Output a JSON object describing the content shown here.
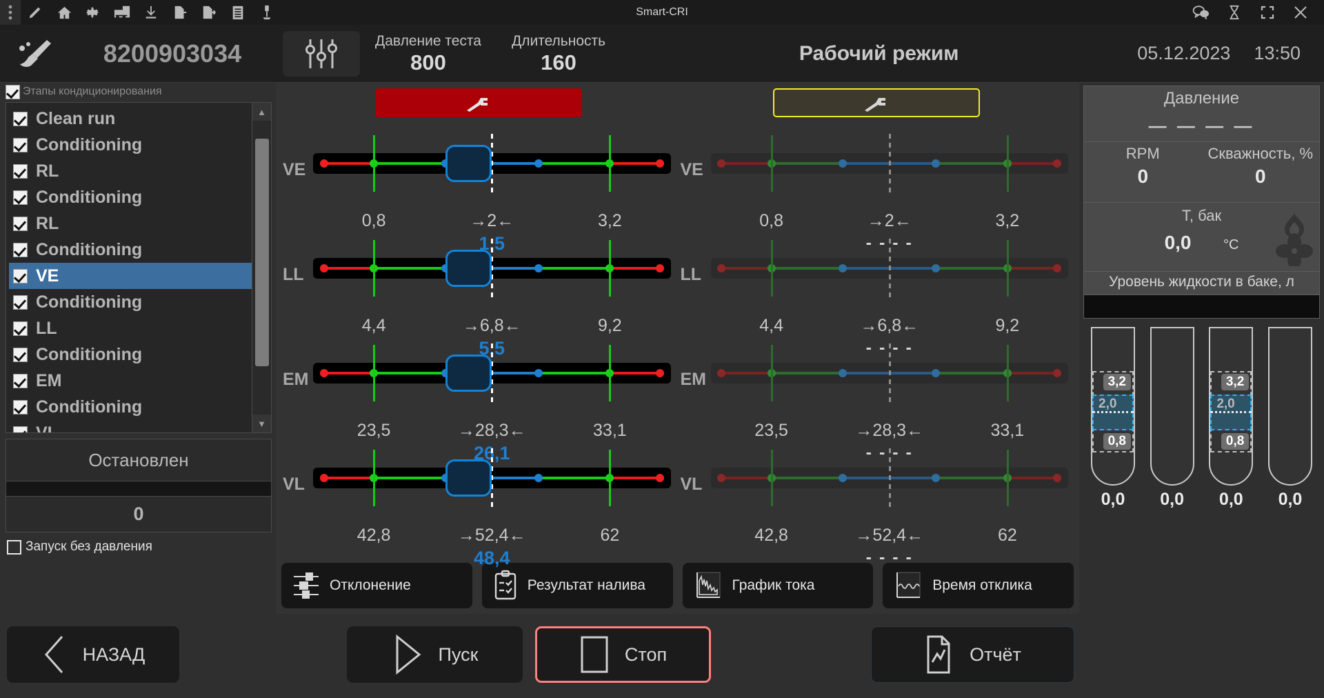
{
  "titlebar": {
    "app_title": "Smart-CRI",
    "left_icons": [
      "grip-dots-icon",
      "pencil-icon",
      "home-icon",
      "gear-icon",
      "toolbox-icon",
      "download-icon",
      "import-icon",
      "export-icon",
      "clipboard-icon",
      "injector-test-icon"
    ],
    "right_icons": [
      "chat-icon",
      "hourglass-icon",
      "fullscreen-icon",
      "close-icon"
    ]
  },
  "header": {
    "brush_icon": "brush-icon",
    "serial": "8200903034",
    "sliders_icon": "sliders-icon",
    "params": [
      {
        "label": "Давление теста",
        "value": "800"
      },
      {
        "label": "Длительность",
        "value": "160"
      }
    ],
    "mode": "Рабочий режим",
    "date": "05.12.2023",
    "time": "13:50"
  },
  "sidebar": {
    "stages_title": "Этапы кондиционирования",
    "stages_checked": true,
    "stages": [
      {
        "label": "Clean run",
        "checked": true,
        "selected": false
      },
      {
        "label": "Conditioning",
        "checked": true,
        "selected": false
      },
      {
        "label": "RL",
        "checked": true,
        "selected": false
      },
      {
        "label": "Conditioning",
        "checked": true,
        "selected": false
      },
      {
        "label": "RL",
        "checked": true,
        "selected": false
      },
      {
        "label": "Conditioning",
        "checked": true,
        "selected": false
      },
      {
        "label": "VE",
        "checked": true,
        "selected": true
      },
      {
        "label": "Conditioning",
        "checked": true,
        "selected": false
      },
      {
        "label": "LL",
        "checked": true,
        "selected": false
      },
      {
        "label": "Conditioning",
        "checked": true,
        "selected": false
      },
      {
        "label": "EM",
        "checked": true,
        "selected": false
      },
      {
        "label": "Conditioning",
        "checked": true,
        "selected": false
      },
      {
        "label": "VL",
        "checked": true,
        "selected": false
      }
    ],
    "status": "Остановлен",
    "counter": "0",
    "no_pressure_label": "Запуск без давления",
    "no_pressure_checked": false
  },
  "gauges": {
    "left_mode_icon": "injector-icon",
    "right_mode_icon": "injector-icon",
    "rows": [
      {
        "name": "VE",
        "min_label": "0,8",
        "target_label": "→2←",
        "max_label": "3,2",
        "value": "1,5",
        "right_value": "- - - -"
      },
      {
        "name": "LL",
        "min_label": "4,4",
        "target_label": "→6,8←",
        "max_label": "9,2",
        "value": "5,5",
        "right_value": "- - - -"
      },
      {
        "name": "EM",
        "min_label": "23,5",
        "target_label": "→28,3←",
        "max_label": "33,1",
        "value": "26,1",
        "right_value": "- - - -"
      },
      {
        "name": "VL",
        "min_label": "42,8",
        "target_label": "→52,4←",
        "max_label": "62",
        "value": "48,4",
        "right_value": "- - - -"
      }
    ]
  },
  "tools": [
    {
      "label": "Отклонение",
      "icon": "deviation-icon"
    },
    {
      "label": "Результат налива",
      "icon": "checklist-icon"
    },
    {
      "label": "График тока",
      "icon": "current-chart-icon"
    },
    {
      "label": "Время отклика",
      "icon": "response-chart-icon"
    }
  ],
  "right_panel": {
    "pressure_label": "Давление",
    "pressure_value": "— — — —",
    "rpm_label": "RPM",
    "rpm_value": "0",
    "duty_label": "Скважность, %",
    "duty_value": "0",
    "temp_label": "Т, бак",
    "temp_value": "0,0",
    "temp_unit": "°C",
    "level_title": "Уровень жидкости в баке, л",
    "tubes": [
      {
        "value": "0,0",
        "high": "3,2",
        "mid": "2,0",
        "low": "0,8",
        "marked": true
      },
      {
        "value": "0,0",
        "marked": false
      },
      {
        "value": "0,0",
        "high": "3,2",
        "mid": "2,0",
        "low": "0,8",
        "marked": true
      },
      {
        "value": "0,0",
        "marked": false
      }
    ]
  },
  "bottom": {
    "back": "НАЗАД",
    "start": "Пуск",
    "stop": "Стоп",
    "report": "Отчёт"
  },
  "colors": {
    "accent_blue": "#1f7fd0",
    "alarm_red": "#ab0008",
    "idle_yellow": "#f3ef22",
    "select_blue": "#3c6e9f",
    "stop_border": "#ff8080"
  }
}
